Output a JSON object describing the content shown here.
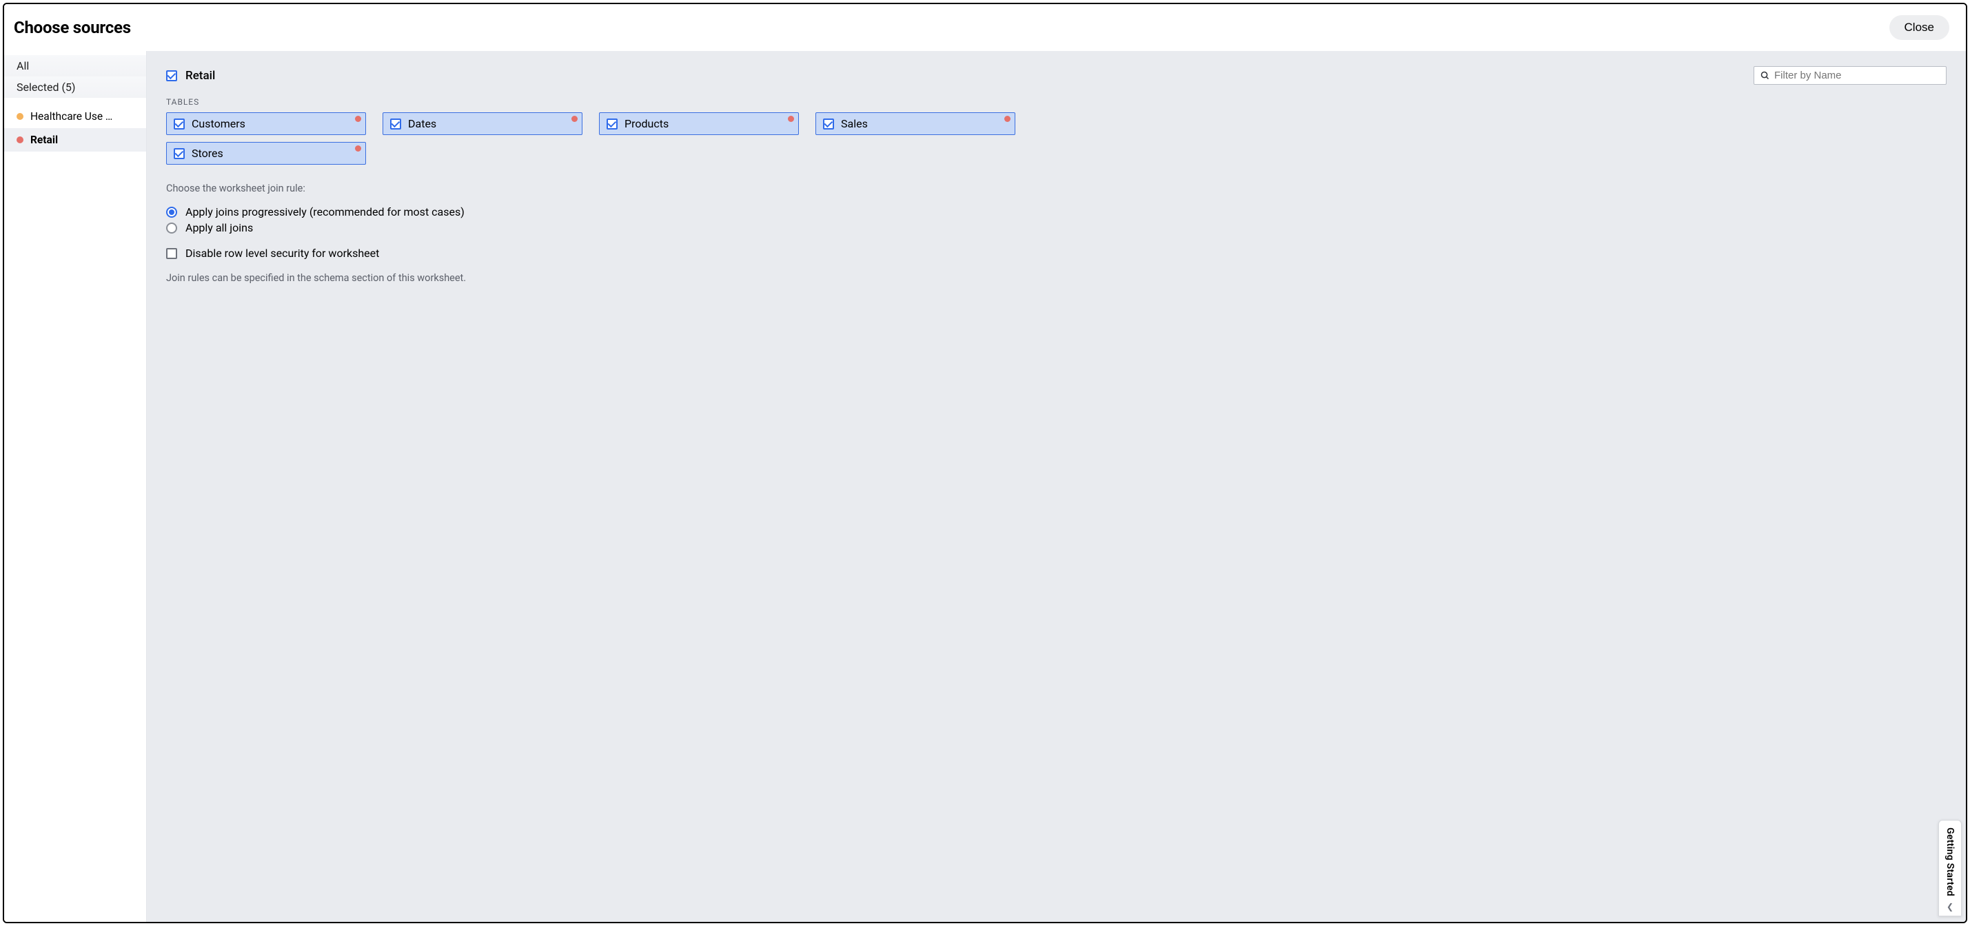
{
  "header": {
    "title": "Choose sources",
    "close_label": "Close"
  },
  "sidebar": {
    "filter_all": "All",
    "filter_selected": "Selected (5)",
    "sources": [
      {
        "label": "Healthcare Use …",
        "color": "orange",
        "active": false
      },
      {
        "label": "Retail",
        "color": "red",
        "active": true
      }
    ]
  },
  "main": {
    "source_name": "Retail",
    "filter_placeholder": "Filter by Name",
    "tables_label": "TABLES",
    "tables": [
      {
        "label": "Customers"
      },
      {
        "label": "Dates"
      },
      {
        "label": "Products"
      },
      {
        "label": "Sales"
      },
      {
        "label": "Stores"
      }
    ],
    "join_rule_prompt": "Choose the worksheet join rule:",
    "join_rules": [
      {
        "label": "Apply joins progressively (recommended for most cases)",
        "selected": true
      },
      {
        "label": "Apply all joins",
        "selected": false
      }
    ],
    "disable_rls_label": "Disable row level security for worksheet",
    "hint": "Join rules can be specified in the schema section of this worksheet."
  },
  "getting_started": {
    "label": "Getting Started"
  }
}
